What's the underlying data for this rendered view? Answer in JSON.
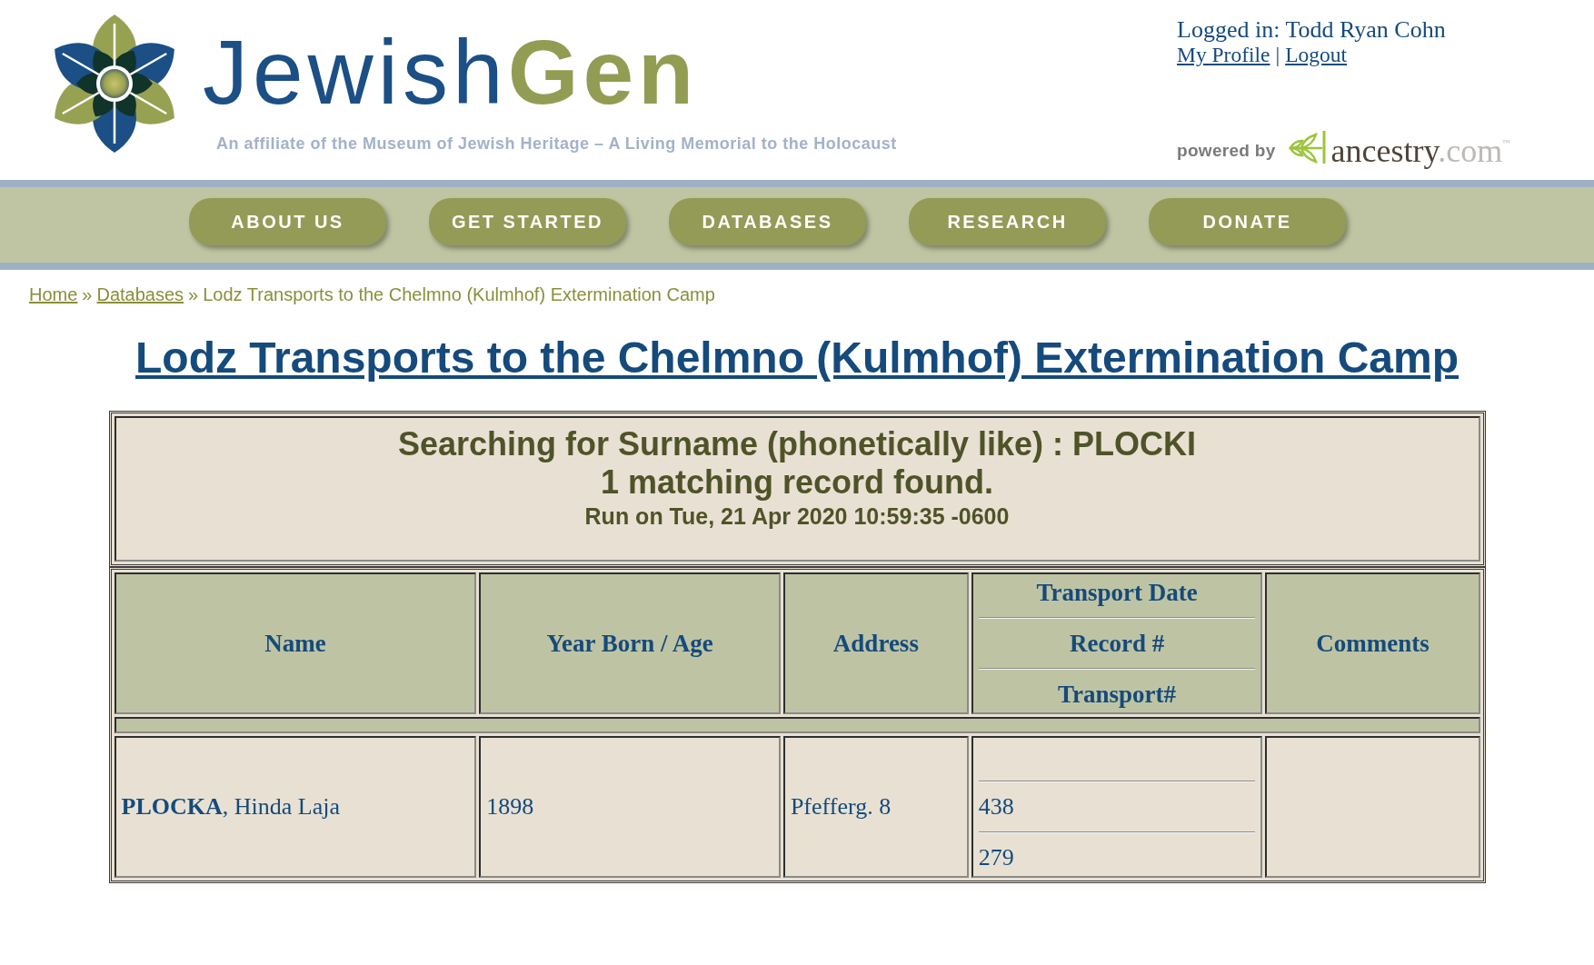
{
  "header": {
    "logo": {
      "wordmark": "Jewish**Gen**",
      "tagline": "An affiliate of the Museum of Jewish Heritage – A Living Memorial to the Holocaust"
    },
    "account": {
      "status": "Logged in: Todd Ryan Cohn",
      "links": [
        {
          "label": "My Profile"
        },
        {
          "label": "Logout"
        }
      ],
      "separator": "|"
    },
    "sponsor": {
      "label": "powered by",
      "brand": [
        {
          "text": "ancestry",
          "color": "#4f4438"
        },
        {
          "text": ".com",
          "color": "#bdb9b3"
        }
      ],
      "trademark": "™"
    }
  },
  "nav": {
    "items": [
      {
        "label": "ABOUT US"
      },
      {
        "label": "GET STARTED"
      },
      {
        "label": "DATABASES"
      },
      {
        "label": "RESEARCH"
      },
      {
        "label": "DONATE"
      }
    ]
  },
  "breadcrumb": [
    {
      "kind": "link",
      "text": "Home"
    },
    {
      "kind": "separator",
      "text": "»"
    },
    {
      "kind": "link",
      "text": "Databases"
    },
    {
      "kind": "separator",
      "text": "»"
    },
    {
      "kind": "current",
      "text": "Lodz Transports to the Chelmno (Kulmhof) Extermination Camp"
    }
  ],
  "page_title": "Lodz Transports to the Chelmno (Kulmhof) Extermination Camp",
  "search_summary": [
    {
      "kind": "heading",
      "text": "Searching for Surname (phonetically like) : PLOCKI"
    },
    {
      "kind": "heading",
      "text": "1 matching record found."
    },
    {
      "kind": "note",
      "text": "Run on Tue, 21 Apr 2020 10:59:35 -0600"
    }
  ],
  "table": {
    "columns": [
      {
        "kind": "single",
        "label": "Name"
      },
      {
        "kind": "single",
        "label": "Year Born / Age"
      },
      {
        "kind": "single",
        "label": "Address"
      },
      {
        "kind": "stacked",
        "labels": [
          "Transport Date",
          "Record #",
          "Transport#"
        ]
      },
      {
        "kind": "single",
        "label": "Comments"
      }
    ],
    "rows": [
      {
        "cells": [
          {
            "kind": "text",
            "text": "**PLOCKA**, Hinda Laja"
          },
          {
            "kind": "text",
            "text": "1898"
          },
          {
            "kind": "text",
            "text": "Pfefferg. 8"
          },
          {
            "kind": "stacked",
            "record": "438",
            "transport": "279"
          },
          {
            "kind": "empty"
          }
        ]
      }
    ]
  }
}
